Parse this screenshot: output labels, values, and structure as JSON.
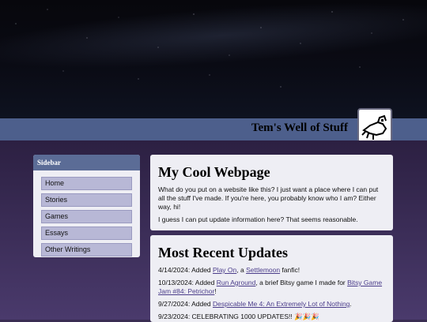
{
  "header": {
    "site_title": "Tem's Well of Stuff",
    "logo_icon": "pixel-bird-icon"
  },
  "sidebar": {
    "title": "Sidebar",
    "items": [
      {
        "label": "Home"
      },
      {
        "label": "Stories"
      },
      {
        "label": "Games"
      },
      {
        "label": "Essays"
      },
      {
        "label": "Other Writings"
      }
    ]
  },
  "intro": {
    "heading": "My Cool Webpage",
    "p1": "What do you put on a website like this? I just want a place where I can put all the stuff I've made. If you're here, you probably know who I am? Either way, hi!",
    "p2": "I guess I can put update information here? That seems reasonable."
  },
  "updates": {
    "heading": "Most Recent Updates",
    "items": [
      {
        "date": "4/14/2024: Added ",
        "link1": "Play On",
        "mid": ", a ",
        "link2": "Settlemoon",
        "end": " fanfic!"
      },
      {
        "date": "10/13/2024: Added ",
        "link1": "Run Aground",
        "mid": ", a brief Bitsy game I made for ",
        "link2": "Bitsy Game Jam #84: Petrichor",
        "end": "!"
      },
      {
        "date": "9/27/2024: Added ",
        "link1": "Despicable Me 4: An Extremely Lot of Nothing",
        "end": "."
      },
      {
        "text": "9/23/2024: CELEBRATING 1000 UPDATES!! 🎉🎉🎉"
      }
    ]
  },
  "colors": {
    "header_bar": "#4d5f8c",
    "sidebar_head": "#5b6c96",
    "nav_item": "#b8b8d6",
    "link": "#4b3d8a"
  }
}
